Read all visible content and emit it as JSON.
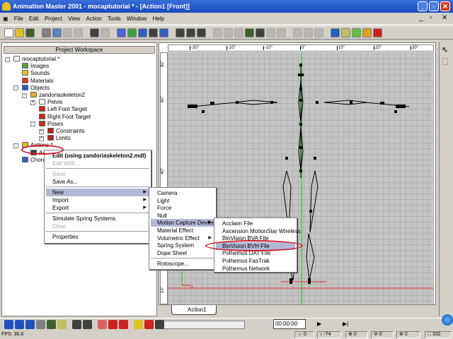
{
  "window": {
    "title": "Animation Master 2001 - mocaptutorial * - [Action1 [Front]]",
    "controls": [
      "_",
      "▫",
      "✕"
    ]
  },
  "menubar": {
    "items": [
      "File",
      "Edit",
      "Project",
      "View",
      "Action",
      "Tools",
      "Window",
      "Help"
    ],
    "doc_controls": [
      "_",
      "▫",
      "✕"
    ]
  },
  "toolbar": {
    "icons": [
      "new-icon",
      "open-icon",
      "save-icon",
      "cut-icon",
      "copy-icon",
      "paste-icon",
      "delete-icon",
      "undo-icon",
      "redo-icon",
      "import-icon",
      "export-icon",
      "render-icon",
      "properties-icon",
      "help-icon",
      "pan-icon",
      "zoom-icon",
      "turn-icon",
      "bones-icon",
      "muscle-icon",
      "skin-icon",
      "animate-icon",
      "action-icon",
      "stride-icon",
      "ik-icon",
      "move-icon",
      "rotate-icon",
      "scale-icon",
      "globe-icon",
      "cursor-icon",
      "path-icon",
      "chart-icon",
      "bulb-icon"
    ]
  },
  "workspace": {
    "title": "Project Workspace",
    "tree": [
      {
        "label": "mocaptutorial *",
        "depth": 0,
        "toggle": "-",
        "icon": "project-icon",
        "color": "#ffffff"
      },
      {
        "label": "Images",
        "depth": 1,
        "icon": "images-icon",
        "color": "#60a040"
      },
      {
        "label": "Sounds",
        "depth": 1,
        "icon": "sounds-icon",
        "color": "#e0c020"
      },
      {
        "label": "Materials",
        "depth": 1,
        "icon": "materials-icon",
        "color": "#d04020"
      },
      {
        "label": "Objects",
        "depth": 1,
        "toggle": "-",
        "icon": "objects-icon",
        "color": "#3060c0"
      },
      {
        "label": "zandoriaskeleton2",
        "depth": 2,
        "toggle": "-",
        "icon": "model-icon",
        "color": "#e0b020"
      },
      {
        "label": "Pelvis",
        "depth": 3,
        "toggle": "+",
        "icon": "bone-icon",
        "color": "#ffffff"
      },
      {
        "label": "Left Foot Target",
        "depth": 3,
        "icon": "target-icon",
        "color": "#d02020"
      },
      {
        "label": "Right Foot Target",
        "depth": 3,
        "icon": "target-icon",
        "color": "#d02020"
      },
      {
        "label": "Poses",
        "depth": 3,
        "toggle": "-",
        "icon": "poses-icon",
        "color": "#c03020"
      },
      {
        "label": "Constraints",
        "depth": 4,
        "toggle": "+",
        "icon": "lips-icon",
        "color": "#c02020"
      },
      {
        "label": "Limits",
        "depth": 4,
        "toggle": "+",
        "icon": "lips-icon",
        "color": "#c02020"
      },
      {
        "label": "Actions *",
        "depth": 1,
        "toggle": "-",
        "icon": "actions-icon",
        "color": "#e0c020"
      },
      {
        "label": "Action1",
        "depth": 2,
        "icon": "action-icon",
        "color": "#404040"
      },
      {
        "label": "Choreog",
        "depth": 1,
        "icon": "choreography-icon",
        "color": "#3060c0"
      }
    ]
  },
  "context_menu": {
    "items": [
      {
        "label": "Edit (using zandoriaskeleton2.mdl)",
        "bold": true
      },
      {
        "label": "Edit With...",
        "disabled": true
      },
      {
        "sep": true
      },
      {
        "label": "Save",
        "disabled": true
      },
      {
        "label": "Save As..."
      },
      {
        "sep": true
      },
      {
        "label": "New",
        "submenu": true,
        "selected": true
      },
      {
        "label": "Import",
        "submenu": true
      },
      {
        "label": "Export",
        "submenu": true
      },
      {
        "sep": true
      },
      {
        "label": "Simulate Spring Systems"
      },
      {
        "label": "Clear",
        "disabled": true
      },
      {
        "sep": true
      },
      {
        "label": "Properties"
      }
    ]
  },
  "new_submenu": {
    "items": [
      {
        "label": "Camera"
      },
      {
        "label": "Light"
      },
      {
        "label": "Force"
      },
      {
        "label": "Null"
      },
      {
        "label": "Motion Capture Device",
        "submenu": true,
        "selected": true
      },
      {
        "label": "Material Effect"
      },
      {
        "label": "Volumetric Effect",
        "submenu": true
      },
      {
        "label": "Spring System"
      },
      {
        "label": "Dope Sheet"
      },
      {
        "sep": true
      },
      {
        "label": "Rotoscope..."
      }
    ]
  },
  "mocap_submenu": {
    "items": [
      {
        "label": "Acclaim File"
      },
      {
        "label": "Ascension MotionStar Wireless"
      },
      {
        "label": "BioVision BVA File"
      },
      {
        "label": "BioVision BVH File",
        "selected": true
      },
      {
        "label": "Polhemus DAT File"
      },
      {
        "label": "Polhemus FasTrak"
      },
      {
        "label": "Polhemus Network"
      }
    ]
  },
  "viewport": {
    "ruler_top": [
      "-30\"",
      "-20\"",
      "-10\"",
      "0\"",
      "10\"",
      "20\"",
      "30\""
    ],
    "ruler_left": [
      "80\"",
      "60\"",
      "40\"",
      "30\"",
      "10\""
    ],
    "axis_labels": {
      "x": "X"
    },
    "colors": {
      "y_axis": "#20c020",
      "x_axis": "#e03030",
      "grid": "#c4c4c4",
      "highlight_ellipse": "#d02030"
    },
    "tab": "Action1"
  },
  "bottom_toolbar": {
    "time": "00:00:00"
  },
  "status": {
    "fps": "FPS: 36.8",
    "x": "0",
    "y": "-74",
    "r1": "0",
    "r2": "0",
    "r3": "0",
    "zoom": "332"
  }
}
